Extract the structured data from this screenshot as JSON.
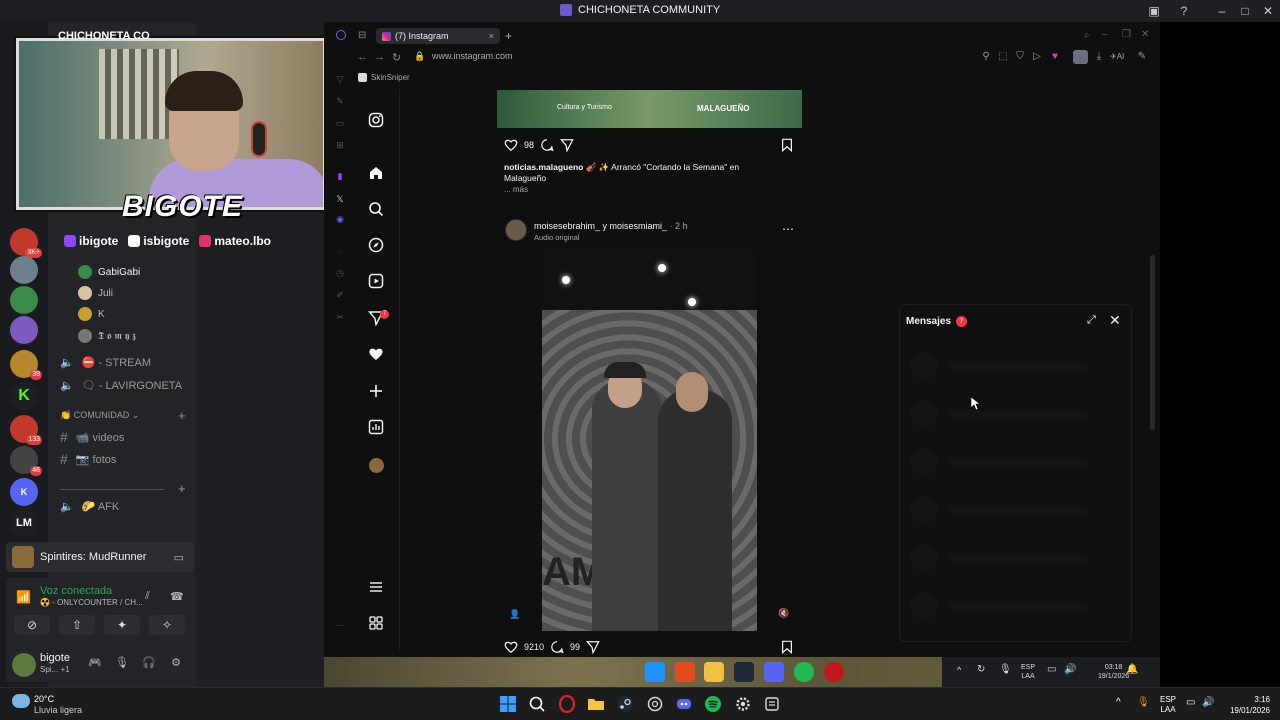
{
  "window": {
    "title": "CHICHONETA COMMUNITY"
  },
  "stream_overlay": {
    "server_name_partial": "CHICHONETA CO",
    "logo_text": "BIGOTE",
    "socials": [
      {
        "icon": "twitch-icon",
        "handle": "ibigote"
      },
      {
        "icon": "tiktok-icon",
        "handle": "isbigote"
      },
      {
        "icon": "instagram-icon",
        "handle": "mateo.lbo"
      }
    ]
  },
  "discord": {
    "server_badges": [
      "3K+",
      "39",
      "133",
      "46"
    ],
    "server_letters": [
      "K",
      "LM"
    ],
    "voice_users": [
      "GabiGabi",
      "Juli",
      "K",
      "𝕿 𝖔 𝖒 𝖞 𝖟"
    ],
    "voice_channels": [
      "⛔ - STREAM",
      "🗨 - LAVIRGONETA"
    ],
    "category": "👏 COMUNIDAD",
    "text_channels": [
      "📹 videos",
      "📷 fotos"
    ],
    "afk_channel": "🌮 AFK",
    "activity": "Spintires: MudRunner",
    "voice_status": "Voz conectada",
    "voice_channel_name": "☢️ - ONLYCOUNTER / CH...",
    "user_name": "bigote",
    "user_sub": "Spi...",
    "user_sub_count": "+1"
  },
  "browser": {
    "tab_label": "(7) Instagram",
    "url": "www.instagram.com",
    "bookmark": "SkinSniper",
    "toolbar_ai": "AI"
  },
  "instagram": {
    "nav_icons": [
      "instagram-logo-icon",
      "home-icon",
      "search-icon",
      "explore-icon",
      "reels-icon",
      "messages-icon",
      "notifications-icon",
      "create-icon",
      "dashboard-icon",
      "profile-icon"
    ],
    "notif_count": "7",
    "banner": {
      "left_text": "Cultura y Turismo",
      "right_text": "MALAGUEÑO"
    },
    "post1": {
      "likes": "98",
      "caption_user": "noticias.malagueno",
      "caption_text": "🎻 ✨ Arrancó \"Cortando la Semana\" en Malagueño",
      "more": "... más"
    },
    "post2": {
      "users": "moisesebrahim_ y moisesmiami_",
      "time": "· 2 h",
      "audio": "Audio original",
      "likes": "9210",
      "comments": "99",
      "reel_bg_text": "AM  PK"
    }
  },
  "messages_panel": {
    "title": "Mensajes",
    "badge": "7"
  },
  "inner_taskbar": {
    "lang": [
      "ESP",
      "LAA"
    ],
    "time": "03:18",
    "date": "19/1/2026"
  },
  "taskbar": {
    "weather_temp": "20°C",
    "weather_desc": "Lluvia ligera",
    "lang": [
      "ESP",
      "LAA"
    ],
    "time": "3:16",
    "date": "19/01/2026"
  }
}
